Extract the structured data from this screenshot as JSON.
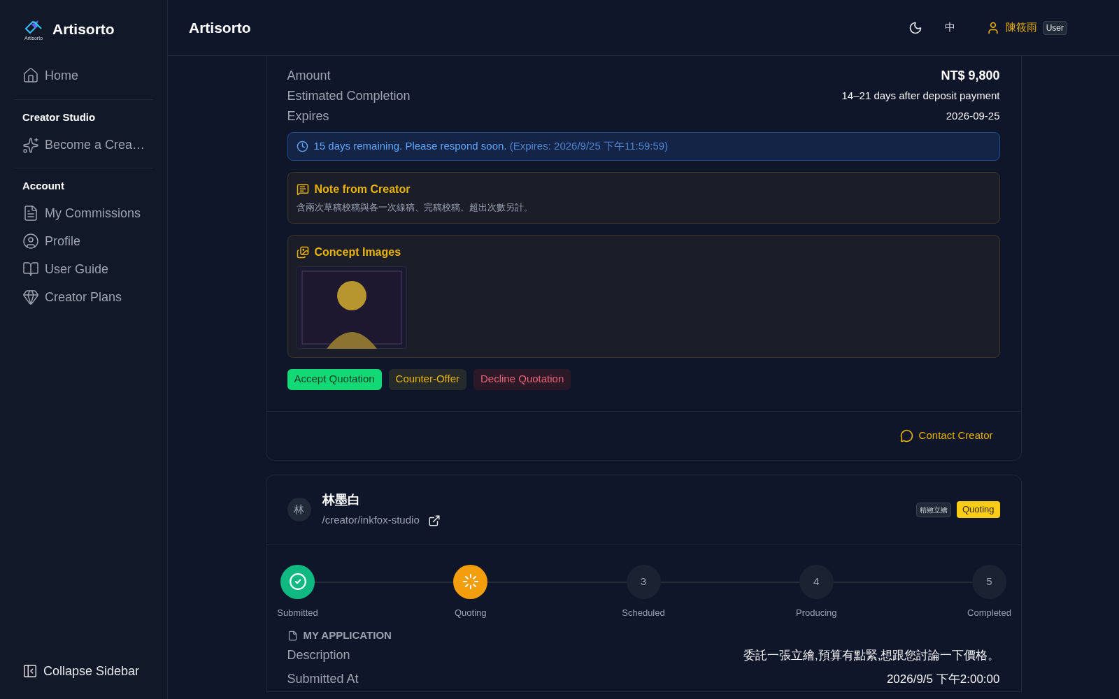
{
  "sidebar": {
    "brand": "Artisorto",
    "logo_caption": "Artisorto",
    "sections": [
      {
        "items": [
          {
            "label": "Home"
          }
        ]
      },
      {
        "title": "Creator Studio",
        "items": [
          {
            "label": "Become a Crea…"
          }
        ]
      },
      {
        "title": "Account",
        "items": [
          {
            "label": "My Commissions"
          },
          {
            "label": "Profile"
          },
          {
            "label": "User Guide"
          },
          {
            "label": "Creator Plans"
          }
        ]
      }
    ],
    "collapse": "Collapse Sidebar"
  },
  "header": {
    "title": "Artisorto",
    "language": "中",
    "user": {
      "name": "陳筱雨",
      "role": "User"
    }
  },
  "quotation": {
    "rows": [
      {
        "label": "Amount",
        "value": "NT$ 9,800",
        "emphasis": true
      },
      {
        "label": "Estimated Completion",
        "value": "14–21 days after deposit payment",
        "emphasis": false
      },
      {
        "label": "Expires",
        "value": "2026-09-25",
        "emphasis": false
      }
    ],
    "alert": {
      "text": "15 days remaining. Please respond soon.",
      "detail": "(Expires: 2026/9/25 下午11:59:59)"
    },
    "note": {
      "title": "Note from Creator",
      "text": "含兩次草稿校稿與各一次線稿、完稿校稿。超出次數另計。"
    },
    "concept": {
      "title": "Concept Images"
    },
    "actions": [
      {
        "label": "Accept Quotation",
        "kind": "accept"
      },
      {
        "label": "Counter-Offer",
        "kind": "counter"
      },
      {
        "label": "Decline Quotation",
        "kind": "decline"
      }
    ],
    "contact": "Contact Creator"
  },
  "commission": {
    "avatar": "林",
    "name": "林墨白",
    "path": "/creator/inkfox-studio",
    "tag": "精緻立繪",
    "status": "Quoting",
    "steps": [
      {
        "label": "Submitted",
        "kind": "done"
      },
      {
        "label": "Quoting",
        "kind": "current"
      },
      {
        "label": "Scheduled",
        "kind": "pending",
        "number": "3"
      },
      {
        "label": "Producing",
        "kind": "pending",
        "number": "4"
      },
      {
        "label": "Completed",
        "kind": "pending",
        "number": "5"
      }
    ],
    "application": {
      "title": "MY APPLICATION",
      "rows": [
        {
          "label": "Description",
          "value": "委託一張立繪,預算有點緊,想跟您討論一下價格。"
        },
        {
          "label": "Submitted At",
          "value": "2026/9/5 下午2:00:00"
        }
      ]
    }
  }
}
